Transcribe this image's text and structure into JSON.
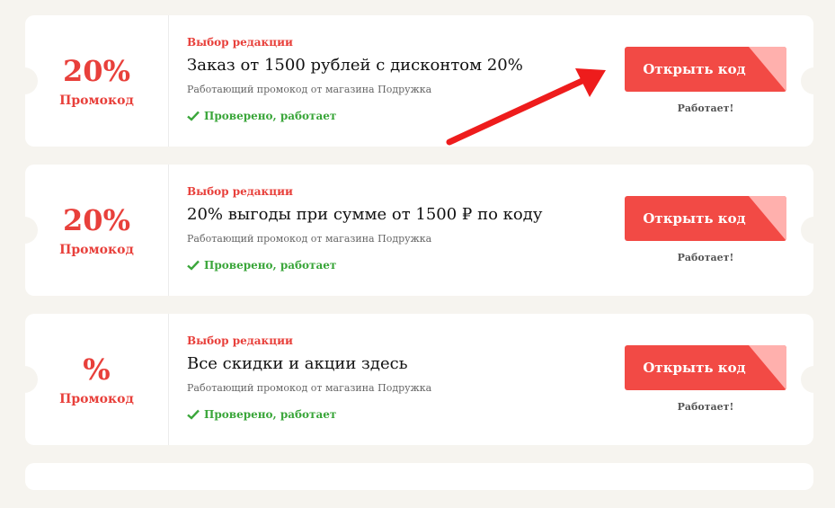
{
  "colors": {
    "accent": "#e8403b",
    "button": "#f24a45",
    "button_corner": "#ffb0ad",
    "verified": "#3aa63a",
    "arrow": "#ee1c1c",
    "background": "#f6f4ef"
  },
  "coupons": [
    {
      "value": "20%",
      "promo_label": "Промокод",
      "editor_label": "Выбор редакции",
      "title": "Заказ от 1500 рублей с дисконтом 20%",
      "description": "Работающий промокод от магазина Подружка",
      "verified": "Проверено, работает",
      "button_label": "Открыть код",
      "status": "Работает!"
    },
    {
      "value": "20%",
      "promo_label": "Промокод",
      "editor_label": "Выбор редакции",
      "title": "20% выгоды при сумме от 1500 ₽ по коду",
      "description": "Работающий промокод от магазина Подружка",
      "verified": "Проверено, работает",
      "button_label": "Открыть код",
      "status": "Работает!"
    },
    {
      "value": "%",
      "promo_label": "Промокод",
      "editor_label": "Выбор редакции",
      "title": "Все скидки и акции здесь",
      "description": "Работающий промокод от магазина Подружка",
      "verified": "Проверено, работает",
      "button_label": "Открыть код",
      "status": "Работает!"
    }
  ],
  "icons": {
    "verified": "check-icon",
    "annotation": "red-arrow-icon"
  }
}
